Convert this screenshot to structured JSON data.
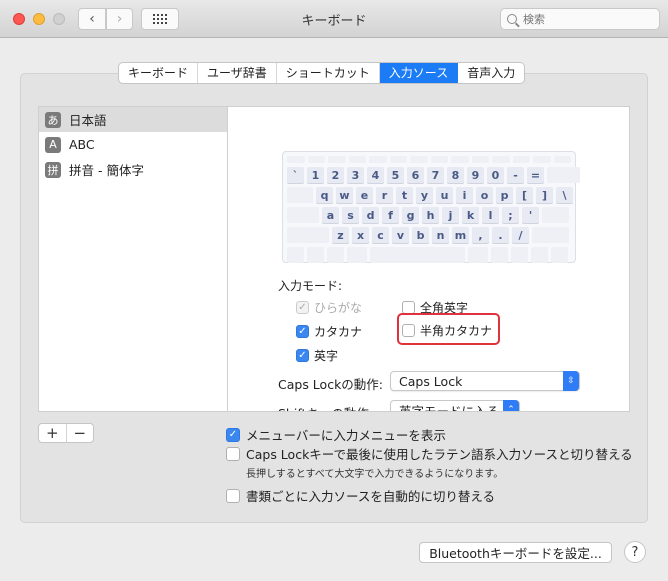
{
  "window": {
    "title": "キーボード",
    "search_placeholder": "検索",
    "controls": {
      "back": "‹",
      "forward": "›"
    }
  },
  "tabs": [
    {
      "label": "キーボード",
      "active": false
    },
    {
      "label": "ユーザ辞書",
      "active": false
    },
    {
      "label": "ショートカット",
      "active": false
    },
    {
      "label": "入力ソース",
      "active": true
    },
    {
      "label": "音声入力",
      "active": false
    }
  ],
  "sources": [
    {
      "badge": "あ",
      "label": "日本語",
      "selected": true
    },
    {
      "badge": "A",
      "label": "ABC",
      "selected": false
    },
    {
      "badge": "拼",
      "label": "拼音 - 簡体字",
      "selected": false
    }
  ],
  "keyboard": {
    "row1": [
      "`",
      "1",
      "2",
      "3",
      "4",
      "5",
      "6",
      "7",
      "8",
      "9",
      "0",
      "-",
      "="
    ],
    "row2": [
      "q",
      "w",
      "e",
      "r",
      "t",
      "y",
      "u",
      "i",
      "o",
      "p",
      "[",
      "]",
      "\\"
    ],
    "row3": [
      "a",
      "s",
      "d",
      "f",
      "g",
      "h",
      "j",
      "k",
      "l",
      ";",
      "'"
    ],
    "row4": [
      "z",
      "x",
      "c",
      "v",
      "b",
      "n",
      "m",
      ",",
      ".",
      "/"
    ]
  },
  "input_mode": {
    "label": "入力モード:",
    "options": [
      {
        "label": "ひらがな",
        "checked": true,
        "disabled": true
      },
      {
        "label": "全角英字",
        "checked": false,
        "disabled": false
      },
      {
        "label": "カタカナ",
        "checked": true,
        "disabled": false
      },
      {
        "label": "半角カタカナ",
        "checked": false,
        "disabled": false,
        "highlighted": true
      },
      {
        "label": "英字",
        "checked": true,
        "disabled": false
      }
    ]
  },
  "caps_lock": {
    "label": "Caps Lockの動作:",
    "value": "Caps Lock"
  },
  "shift_key": {
    "label": "Shiftキーの動作:",
    "value": "英字モードに入る"
  },
  "list_buttons": {
    "add": "+",
    "remove": "−"
  },
  "options": [
    {
      "label": "メニューバーに入力メニューを表示",
      "checked": true
    },
    {
      "label": "Caps Lockキーで最後に使用したラテン語系入力ソースと切り替える",
      "checked": false
    },
    {
      "label": "書類ごとに入力ソースを自動的に切り替える",
      "checked": false
    }
  ],
  "caps_note": "長押しするとすべて大文字で入力できるようになります。",
  "bluetooth_button": "Bluetoothキーボードを設定...",
  "help_button": "?",
  "colors": {
    "accent": "#1b7cf5",
    "highlight": "#e0323b"
  }
}
